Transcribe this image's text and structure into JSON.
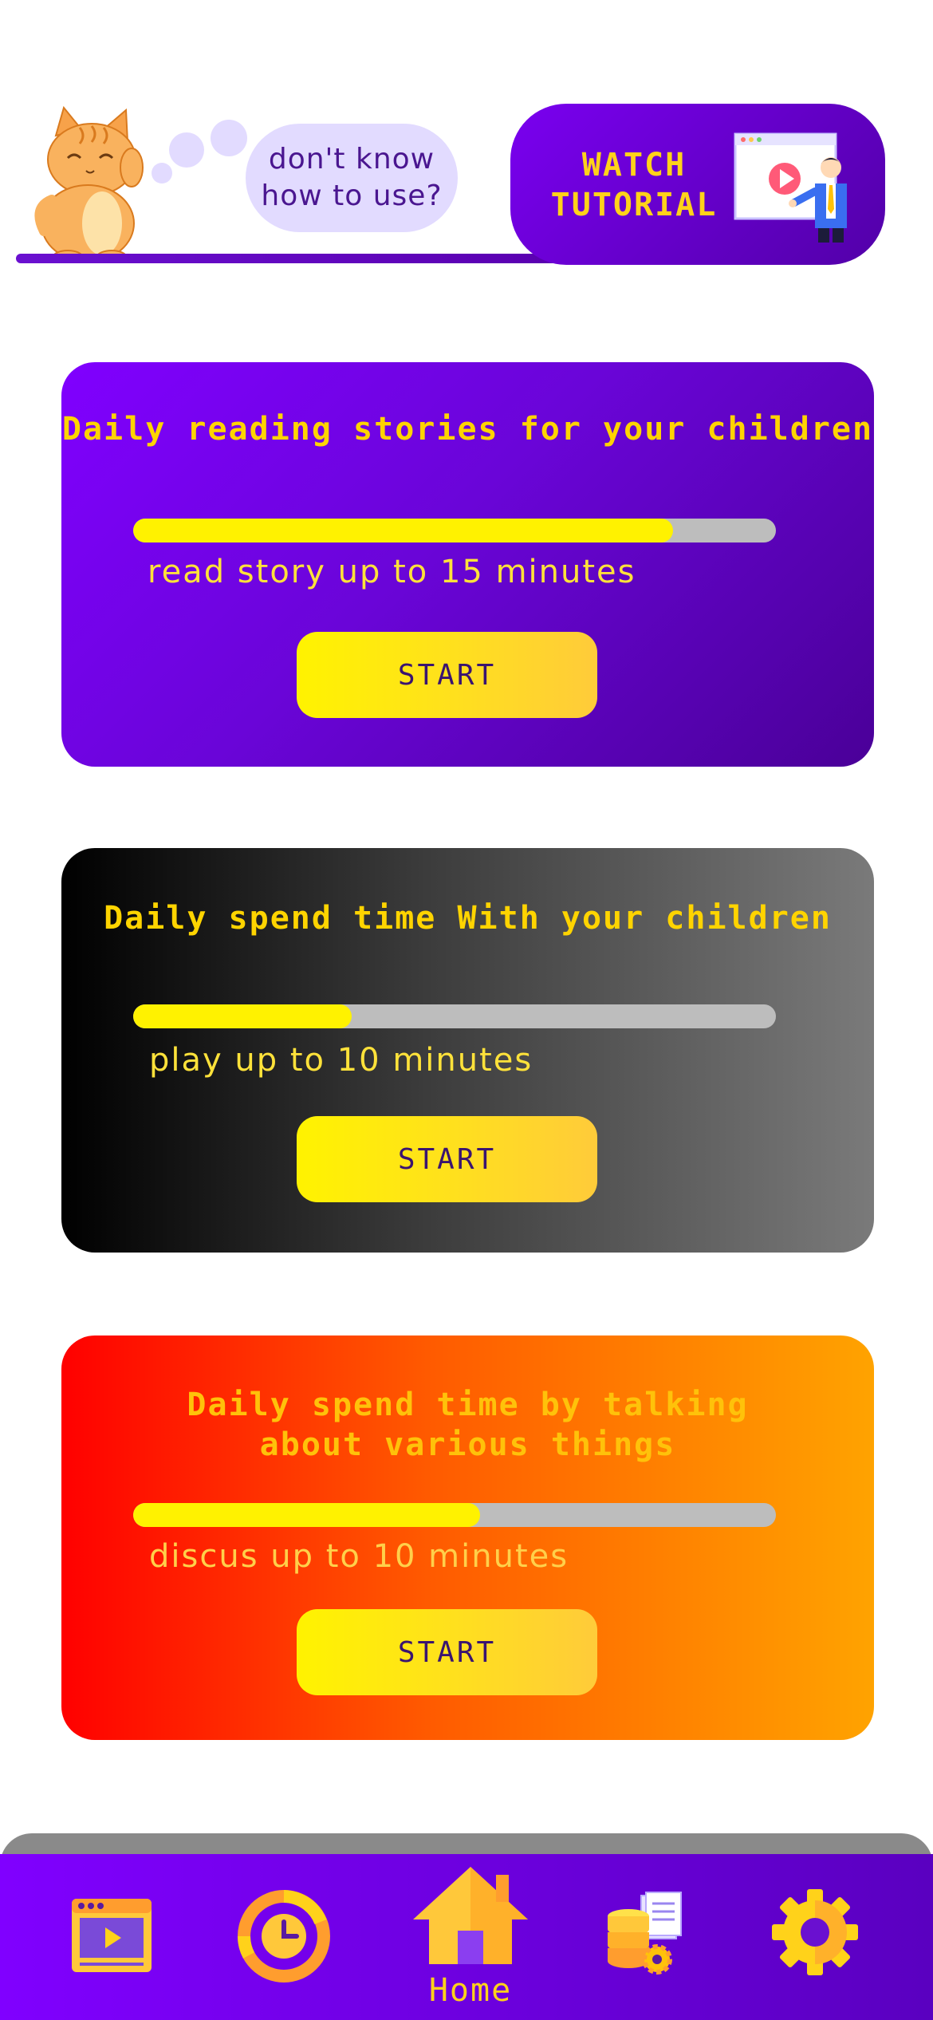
{
  "header": {
    "question": "don't know\nhow to use?",
    "tutorial_label": "WATCH\nTUTORIAL"
  },
  "tasks": [
    {
      "title": "Daily reading stories for your children",
      "description": "read story up to 15 minutes",
      "progress": 0.84,
      "button": "START"
    },
    {
      "title": "Daily spend time With your children",
      "description": "play up to 10 minutes",
      "progress": 0.34,
      "button": "START"
    },
    {
      "title": "Daily spend time by talking\nabout various things",
      "description": "discus up to 10 minutes",
      "progress": 0.54,
      "button": "START"
    }
  ],
  "nav": {
    "items": [
      {
        "icon": "video-player-icon"
      },
      {
        "icon": "clock-chart-icon"
      },
      {
        "icon": "home-icon",
        "label": "Home"
      },
      {
        "icon": "database-settings-icon"
      },
      {
        "icon": "gear-icon"
      }
    ]
  },
  "colors": {
    "brand_purple": "#7a00f0",
    "accent_yellow": "#ffd21a",
    "card_purple": "#6a05d8",
    "card_orange": "#ff5a00"
  }
}
